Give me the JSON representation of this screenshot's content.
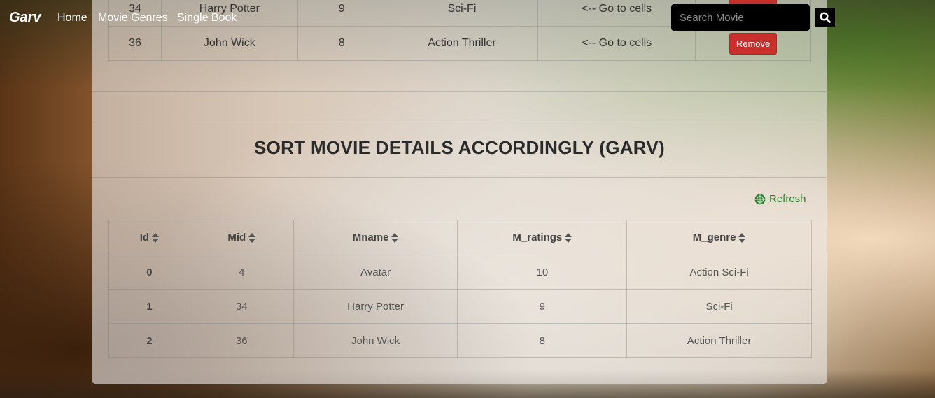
{
  "navbar": {
    "brand": "Garv",
    "links": [
      "Home",
      "Movie Genres",
      "Single Book"
    ],
    "search_placeholder": "Search Movie"
  },
  "top_table": {
    "rows": [
      [
        "34",
        "Harry Potter",
        "9",
        "Sci-Fi",
        "<-- Go to cells"
      ],
      [
        "36",
        "John Wick",
        "8",
        "Action Thriller",
        "<-- Go to cells"
      ]
    ],
    "remove_label": "Remove"
  },
  "section_title": "SORT MOVIE DETAILS ACCORDINGLY (GARV)",
  "refresh_label": "Refresh",
  "sort_table": {
    "headers": [
      "Id",
      "Mid",
      "Mname",
      "M_ratings",
      "M_genre"
    ],
    "rows": [
      [
        "0",
        "4",
        "Avatar",
        "10",
        "Action Sci-Fi"
      ],
      [
        "1",
        "34",
        "Harry Potter",
        "9",
        "Sci-Fi"
      ],
      [
        "2",
        "36",
        "John Wick",
        "8",
        "Action Thriller"
      ]
    ]
  },
  "icons": {
    "search": "search-icon",
    "refresh": "refresh-icon",
    "sort": "sort-icon"
  },
  "colors": {
    "remove_button": "#c9302c",
    "refresh_text": "#2e7d32",
    "navbar_text": "#ffffff",
    "search_bg": "#000000"
  }
}
